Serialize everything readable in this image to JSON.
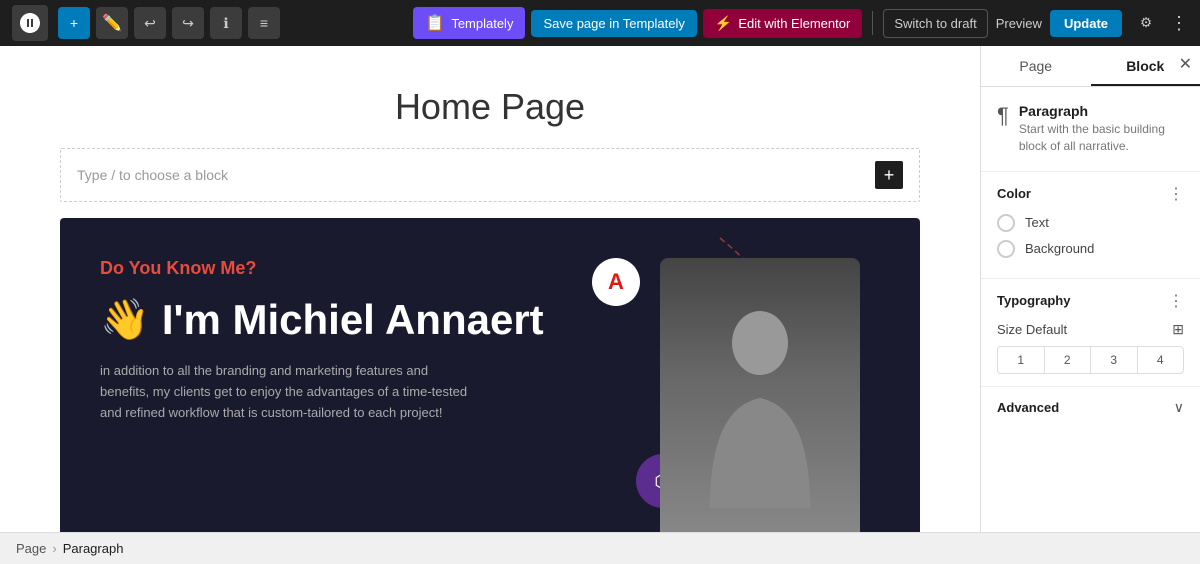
{
  "toolbar": {
    "add_label": "+",
    "undo_label": "↩",
    "redo_label": "↪",
    "info_label": "ℹ",
    "list_label": "≡",
    "templately_label": "Templately",
    "save_label": "Save page in Templately",
    "elementor_label": "Edit with Elementor",
    "switch_draft_label": "Switch to draft",
    "preview_label": "Preview",
    "update_label": "Update",
    "settings_label": "⚙",
    "more_label": "⋮"
  },
  "editor": {
    "page_title": "Home Page",
    "placeholder_text": "Type / to choose a block"
  },
  "hero": {
    "tagline": "Do You Know Me?",
    "name_wave": "👋",
    "name_text": "I'm Michiel Annaert",
    "description": "in addition to all the branding and marketing features and benefits, my clients get to enjoy the advantages of a time-tested and refined workflow that is custom-tailored to each project!"
  },
  "sidebar": {
    "tab_page": "Page",
    "tab_block": "Block",
    "block_name": "Paragraph",
    "block_description": "Start with the basic building block of all narrative.",
    "color_section_title": "Color",
    "text_label": "Text",
    "background_label": "Background",
    "typography_section_title": "Typography",
    "size_default_label": "Size Default",
    "size_1": "1",
    "size_2": "2",
    "size_3": "3",
    "size_4": "4",
    "advanced_label": "Advanced"
  },
  "breadcrumb": {
    "home": "Page",
    "separator": "›",
    "current": "Paragraph"
  },
  "colors": {
    "accent": "#007cba",
    "templately": "#6c4df6",
    "elementor": "#92003b",
    "hero_bg": "#1a1a2e",
    "hero_tagline": "#e74c3c"
  }
}
